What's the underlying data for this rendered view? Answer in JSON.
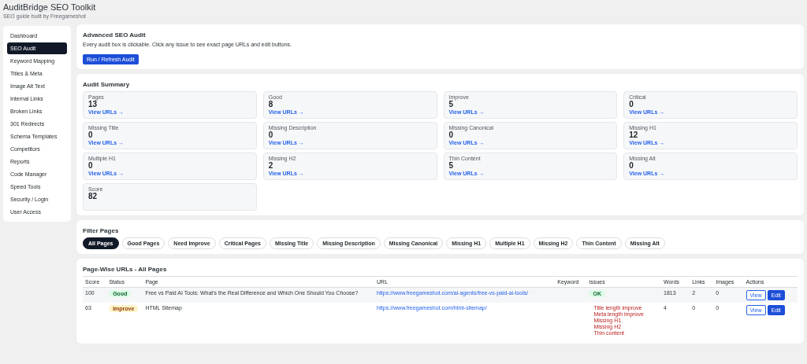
{
  "header": {
    "title": "AuditBridge SEO Toolkit",
    "subtitle": "SEO guide built by Freegameshot"
  },
  "sidebar": {
    "items": [
      {
        "label": "Dashboard",
        "selected": false
      },
      {
        "label": "SEO Audit",
        "selected": true
      },
      {
        "label": "Keyword Mapping",
        "selected": false
      },
      {
        "label": "Titles & Meta",
        "selected": false
      },
      {
        "label": "Image Alt Text",
        "selected": false
      },
      {
        "label": "Internal Links",
        "selected": false
      },
      {
        "label": "Broken Links",
        "selected": false
      },
      {
        "label": "301 Redirects",
        "selected": false
      },
      {
        "label": "Schema Templates",
        "selected": false
      },
      {
        "label": "Competitors",
        "selected": false
      },
      {
        "label": "Reports",
        "selected": false
      },
      {
        "label": "Code Manager",
        "selected": false
      },
      {
        "label": "Speed Tools",
        "selected": false
      },
      {
        "label": "Security / Login",
        "selected": false
      },
      {
        "label": "User Access",
        "selected": false
      }
    ]
  },
  "audit": {
    "title": "Advanced SEO Audit",
    "description": "Every audit box is clickable. Click any issue to see exact page URLs and edit buttons.",
    "button": "Run / Refresh Audit"
  },
  "summary": {
    "title": "Audit Summary",
    "tiles": [
      {
        "label": "Pages",
        "value": "13",
        "link": "View URLs →"
      },
      {
        "label": "Good",
        "value": "8",
        "link": "View URLs →"
      },
      {
        "label": "Improve",
        "value": "5",
        "link": "View URLs →"
      },
      {
        "label": "Critical",
        "value": "0",
        "link": "View URLs →"
      },
      {
        "label": "Missing Title",
        "value": "0",
        "link": "View URLs →"
      },
      {
        "label": "Missing Description",
        "value": "0",
        "link": "View URLs →"
      },
      {
        "label": "Missing Canonical",
        "value": "0",
        "link": "View URLs →"
      },
      {
        "label": "Missing H1",
        "value": "12",
        "link": "View URLs →"
      },
      {
        "label": "Multiple H1",
        "value": "0",
        "link": "View URLs →"
      },
      {
        "label": "Missing H2",
        "value": "2",
        "link": "View URLs →"
      },
      {
        "label": "Thin Content",
        "value": "5",
        "link": "View URLs →"
      },
      {
        "label": "Missing Alt",
        "value": "0",
        "link": "View URLs →"
      },
      {
        "label": "Score",
        "value": "82"
      }
    ]
  },
  "filters": {
    "title": "Filter Pages",
    "items": [
      {
        "label": "All Pages",
        "selected": true
      },
      {
        "label": "Good Pages",
        "selected": false
      },
      {
        "label": "Need Improve",
        "selected": false
      },
      {
        "label": "Critical Pages",
        "selected": false
      },
      {
        "label": "Missing Title",
        "selected": false
      },
      {
        "label": "Missing Description",
        "selected": false
      },
      {
        "label": "Missing Canonical",
        "selected": false
      },
      {
        "label": "Missing H1",
        "selected": false
      },
      {
        "label": "Multiple H1",
        "selected": false
      },
      {
        "label": "Missing H2",
        "selected": false
      },
      {
        "label": "Thin Content",
        "selected": false
      },
      {
        "label": "Missing Alt",
        "selected": false
      }
    ]
  },
  "table": {
    "title": "Page-Wise URLs - All Pages",
    "columns": [
      "Score",
      "Status",
      "Page",
      "URL",
      "Keyword",
      "Issues",
      "Words",
      "Links",
      "Images",
      "Actions"
    ],
    "rows": [
      {
        "score": "100",
        "status": {
          "text": "Good",
          "kind": "good"
        },
        "page": "Free vs Paid AI Tools: What's the Real Difference and Which One Should You Choose?",
        "url": "https://www.freegameshot.com/ai-agents/free-vs-paid-ai-tools/",
        "issues": [
          {
            "text": "OK",
            "kind": "ok"
          }
        ],
        "words": "1813",
        "links": "2",
        "images": "0",
        "actions": [
          "View",
          "Edit"
        ]
      },
      {
        "score": "63",
        "status": {
          "text": "Improve",
          "kind": "improve"
        },
        "page": "HTML Sitemap",
        "url": "https://www.freegameshot.com/html-sitemap/",
        "issues": [
          {
            "text": "Title length improve",
            "kind": "problem"
          },
          {
            "text": "Meta length improve",
            "kind": "problem"
          },
          {
            "text": "Missing H1",
            "kind": "problem"
          },
          {
            "text": "Missing H2",
            "kind": "problem"
          },
          {
            "text": "Thin content",
            "kind": "problem"
          }
        ],
        "words": "4",
        "links": "0",
        "images": "0",
        "actions": [
          "View",
          "Edit"
        ]
      }
    ]
  }
}
